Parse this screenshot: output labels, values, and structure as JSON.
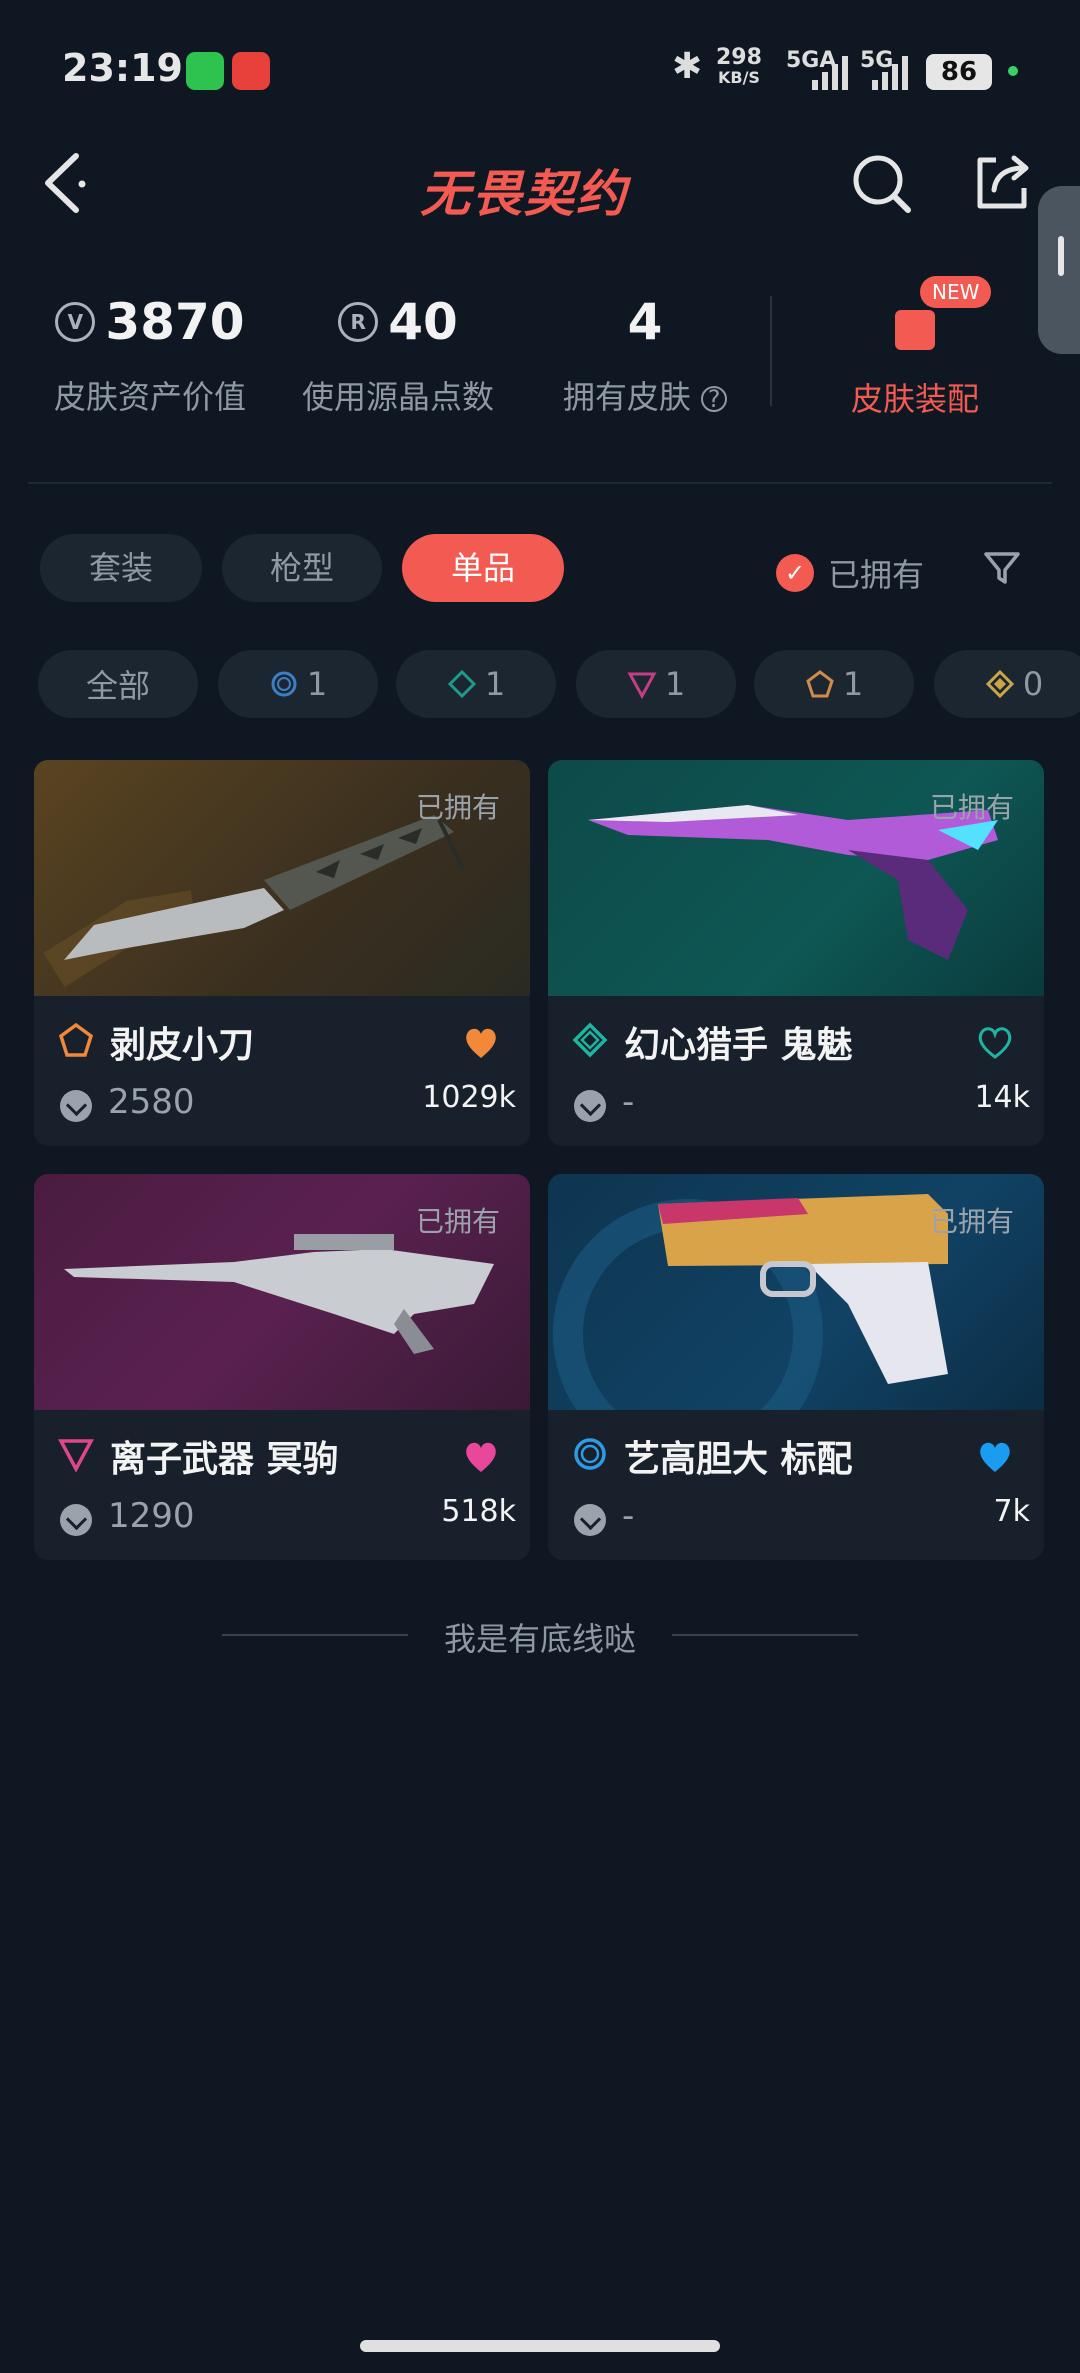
{
  "status_bar": {
    "time": "23:19",
    "net_speed_value": "298",
    "net_speed_unit": "KB/S",
    "signal1_label": "5GA",
    "signal2_label": "5G",
    "battery": "86",
    "bluetooth_icon": "bluetooth-icon"
  },
  "header": {
    "logo_text": "无畏契约",
    "icons": [
      "back-icon",
      "search-icon",
      "share-icon"
    ]
  },
  "stats": [
    {
      "value": "3870",
      "label": "皮肤资产价值",
      "icon": "vp-coin-icon"
    },
    {
      "value": "40",
      "label": "使用源晶点数",
      "icon": "radianite-icon"
    },
    {
      "value": "4",
      "label": "拥有皮肤",
      "icon": "help-icon"
    }
  ],
  "equip": {
    "label": "皮肤装配",
    "badge": "NEW"
  },
  "tabs": [
    {
      "label": "套装",
      "active": false
    },
    {
      "label": "枪型",
      "active": false
    },
    {
      "label": "单品",
      "active": true
    }
  ],
  "owned_filter": {
    "label": "已拥有",
    "checked": true
  },
  "rarity_chips": [
    {
      "label": "全部"
    },
    {
      "count": "1",
      "color": "#3b7fc6"
    },
    {
      "count": "1",
      "color": "#1e9a8a"
    },
    {
      "count": "1",
      "color": "#c23f86"
    },
    {
      "count": "1",
      "color": "#d08a4a"
    },
    {
      "count": "0",
      "color": "#c9a548"
    }
  ],
  "cards": [
    {
      "name": "剥皮小刀",
      "price": "2580",
      "likes": "1029k",
      "owned": "已拥有",
      "tier_color": "#f2883a",
      "heart_color": "#f2883a",
      "heart_filled": true
    },
    {
      "name": "幻心猎手 鬼魅",
      "price": "-",
      "likes": "14k",
      "owned": "已拥有",
      "tier_color": "#1fb3a0",
      "heart_color": "#1fb3a0",
      "heart_filled": false
    },
    {
      "name": "离子武器 冥驹",
      "price": "1290",
      "likes": "518k",
      "owned": "已拥有",
      "tier_color": "#e0468e",
      "heart_color": "#e9479a",
      "heart_filled": true
    },
    {
      "name": "艺高胆大 标配",
      "price": "-",
      "likes": "7k",
      "owned": "已拥有",
      "tier_color": "#2f9be0",
      "heart_color": "#1a9cf0",
      "heart_filled": true
    }
  ],
  "footer": {
    "note": "我是有底线哒"
  },
  "colors": {
    "accent": "#f25a52",
    "background": "#0f1822",
    "card": "#17202b"
  }
}
